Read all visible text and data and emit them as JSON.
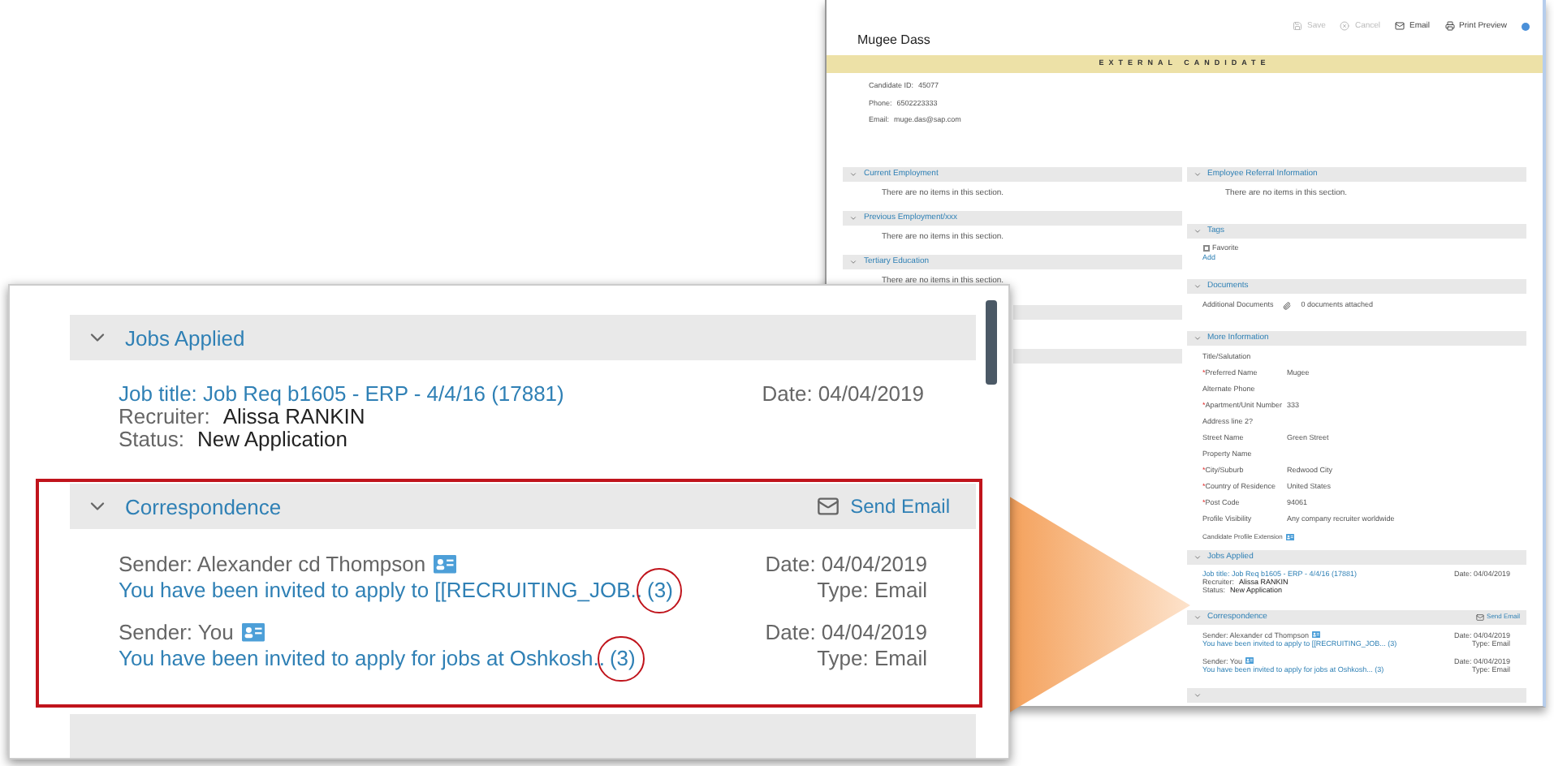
{
  "background_window": {
    "toolbar": [
      {
        "kind": "save",
        "label": "Save",
        "disabled": true
      },
      {
        "kind": "cancel",
        "label": "Cancel",
        "disabled": true
      },
      {
        "kind": "email",
        "label": "Email",
        "disabled": false
      },
      {
        "kind": "print",
        "label": "Print Preview",
        "disabled": false
      }
    ],
    "candidate_name": "Mugee Dass",
    "banner": "EXTERNAL CANDIDATE",
    "contact": [
      {
        "label": "Candidate ID:",
        "value": "45077"
      },
      {
        "label": "Phone:",
        "value": "6502223333"
      },
      {
        "label": "Email:",
        "value": "muge.das@sap.com"
      }
    ],
    "left_sections": [
      {
        "title": "Current Employment",
        "empty_text": "There are no items in this section."
      },
      {
        "title": "Previous Employment/xxx",
        "empty_text": "There are no items in this section."
      },
      {
        "title": "Tertiary Education",
        "empty_text": "There are no items in this section."
      }
    ],
    "referral": {
      "title": "Employee Referral Information",
      "empty_text": "There are no items in this section."
    },
    "tags": {
      "title": "Tags",
      "items": [
        {
          "label": "Favorite",
          "checked": false
        }
      ],
      "add_link": "Add"
    },
    "documents": {
      "title": "Documents",
      "label": "Additional Documents",
      "value": "0 documents attached"
    },
    "more_information": {
      "title": "More Information",
      "fields": [
        {
          "label": "Title/Salutation",
          "required": false
        },
        {
          "label": "Preferred Name",
          "required": true,
          "value": "Mugee"
        },
        {
          "label": "Alternate Phone",
          "required": false
        },
        {
          "label": "Apartment/Unit Number",
          "required": true,
          "value": "333"
        },
        {
          "label": "Address line 2?",
          "required": false
        },
        {
          "label": "Street Name",
          "required": false,
          "value": "Green Street"
        },
        {
          "label": "Property Name",
          "required": false
        },
        {
          "label": "City/Suburb",
          "required": true,
          "value": "Redwood City"
        },
        {
          "label": "Country of Residence",
          "required": true,
          "value": "United States"
        },
        {
          "label": "Post Code",
          "required": true,
          "value": "94061"
        },
        {
          "label": "Profile Visibility",
          "required": false,
          "value": "Any company recruiter worldwide"
        }
      ],
      "required_mark": "*",
      "extension_label": "Candidate Profile Extension"
    },
    "jobs_applied": {
      "title": "Jobs Applied",
      "job_title": "Job title: Job Req b1605 - ERP - 4/4/16 (17881)",
      "date": "Date: 04/04/2019",
      "recruiter_label": "Recruiter:",
      "recruiter": "Alissa RANKIN",
      "status_label": "Status:",
      "status": "New Application"
    },
    "correspondence": {
      "title": "Correspondence",
      "action": "Send Email",
      "messages": [
        {
          "sender": "Sender: Alexander cd Thompson",
          "subject": "You have been invited to apply to [[RECRUITING_JOB... (3)",
          "date": "Date: 04/04/2019",
          "type": "Type: Email"
        },
        {
          "sender": "Sender: You",
          "subject": "You have been invited to apply for jobs at Oshkosh... (3)",
          "date": "Date: 04/04/2019",
          "type": "Type: Email"
        }
      ]
    }
  },
  "callout": {
    "jobs_applied": {
      "title": "Jobs Applied",
      "expanded": true,
      "job_title": "Job title: Job Req b1605 - ERP - 4/4/16 (17881)",
      "date": "Date: 04/04/2019",
      "recruiter_label": "Recruiter:",
      "recruiter": "Alissa RANKIN",
      "status_label": "Status:",
      "status": "New Application"
    },
    "correspondence": {
      "title": "Correspondence",
      "expanded": true,
      "highlighted": true,
      "action": "Send Email",
      "messages": [
        {
          "sender": "Sender: Alexander cd Thompson",
          "subject": "You have been invited to apply to [[RECRUITING_JOB..",
          "count": "(3)",
          "circled": true,
          "date": "Date: 04/04/2019",
          "type": "Type: Email"
        },
        {
          "sender": "Sender: You",
          "subject": "You have been invited to apply for jobs at Oshkosh..",
          "count": "(3)",
          "circled": true,
          "date": "Date: 04/04/2019",
          "type": "Type: Email"
        }
      ]
    }
  }
}
